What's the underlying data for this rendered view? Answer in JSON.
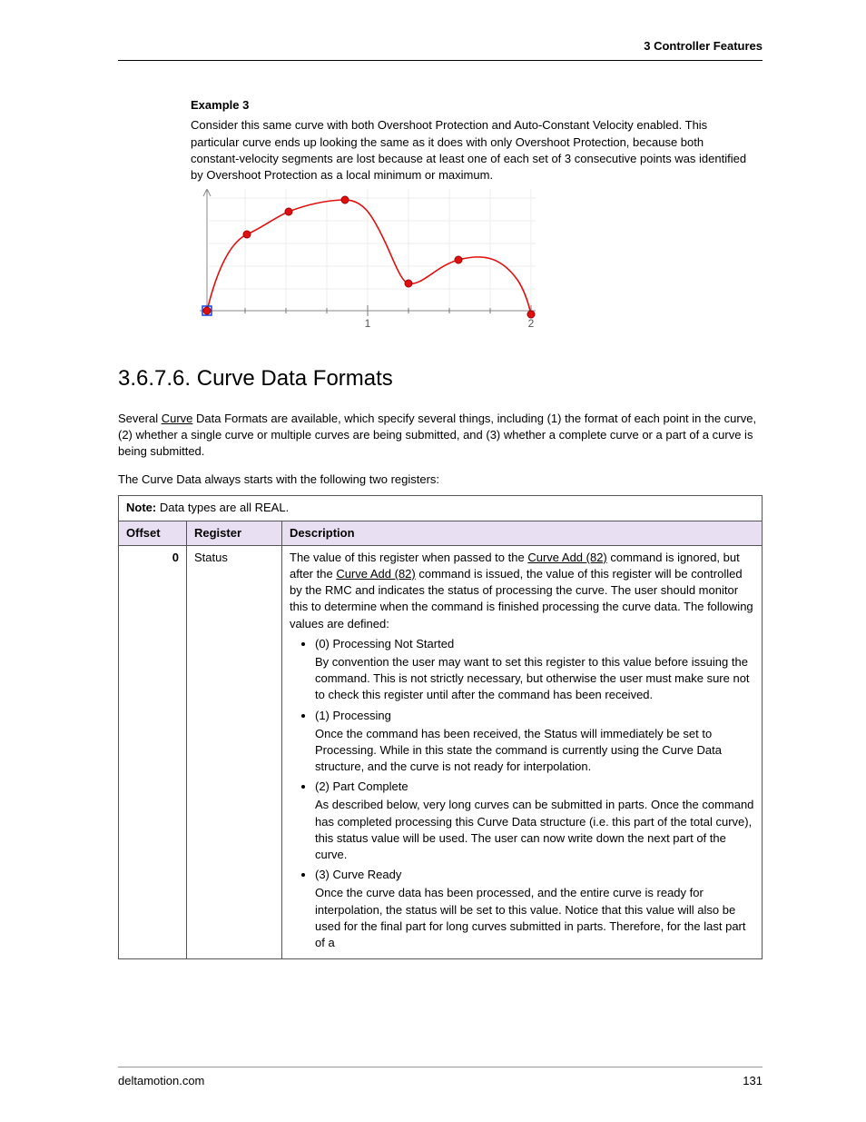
{
  "header": {
    "breadcrumb": "3  Controller Features"
  },
  "example": {
    "title": "Example 3",
    "para": "Consider this same curve with both Overshoot Protection and Auto-Constant Velocity enabled. This particular curve ends up looking the same as it does with only Overshoot Protection, because both constant-velocity segments are lost because at least one of each set of 3 consecutive points was identified by Overshoot Protection as a local minimum or maximum."
  },
  "chart_data": {
    "type": "line",
    "x": [
      0.0,
      0.25,
      0.5,
      0.85,
      1.25,
      1.55,
      1.95
    ],
    "y": [
      0.0,
      0.75,
      0.9,
      1.0,
      0.25,
      0.55,
      -0.05
    ],
    "title": "",
    "xlabel": "",
    "ylabel": "",
    "xlim": [
      0,
      2
    ],
    "ylim": [
      -0.1,
      1.1
    ],
    "x_ticks": [
      1,
      2
    ],
    "x_tick_labels": [
      "1",
      "2"
    ],
    "grid": true,
    "markers": true,
    "line_color": "#e01010",
    "marker_color": "#e01010",
    "start_marker_style": "square-blue"
  },
  "section": {
    "number": "3.6.7.6.",
    "title": "Curve Data Formats"
  },
  "intro": {
    "p1_pre": "Several ",
    "p1_link": "Curve",
    "p1_post": " Data Formats are available, which specify several things, including (1) the format of each point in the curve, (2) whether a single curve or multiple curves are being submitted, and (3) whether a complete curve or a part of a curve is being submitted.",
    "p2": "The Curve Data always starts with the following two registers:"
  },
  "table": {
    "note_label": "Note:",
    "note_text": " Data types are all REAL.",
    "headers": {
      "offset": "Offset",
      "register": "Register",
      "description": "Description"
    },
    "rows": [
      {
        "offset": "0",
        "register": "Status",
        "desc_intro_pre": "The value of this register when passed to the ",
        "desc_intro_link1": "Curve Add (82)",
        "desc_intro_mid": " command is ignored, but after the ",
        "desc_intro_link2": "Curve Add (82)",
        "desc_intro_post": " command is issued, the value of this register will be controlled by the RMC and indicates the status of processing the curve. The user should monitor this to determine when the command is finished processing the curve data. The following values are defined:",
        "items": [
          {
            "label": "(0) Processing Not Started",
            "text": "By convention the user may want to set this register to this value before issuing the command. This is not strictly necessary, but otherwise the user must make sure not to check this register until after the command has been received."
          },
          {
            "label": "(1) Processing",
            "text": "Once the command has been received, the Status will immediately be set to Processing. While in this state the command is currently using the Curve Data structure, and the curve is not ready for interpolation."
          },
          {
            "label": "(2) Part Complete",
            "text": "As described below, very long curves can be submitted in parts. Once the command has completed processing this Curve Data structure (i.e. this part of the total curve), this status value will be used. The user can now write down the next part of the curve."
          },
          {
            "label": "(3) Curve Ready",
            "text": "Once the curve data has been processed, and the entire curve is ready for interpolation, the status will be set to this value. Notice that this value will also be used for the final part for long curves submitted in parts. Therefore, for the last part of a"
          }
        ]
      }
    ]
  },
  "footer": {
    "site": "deltamotion.com",
    "page": "131"
  }
}
